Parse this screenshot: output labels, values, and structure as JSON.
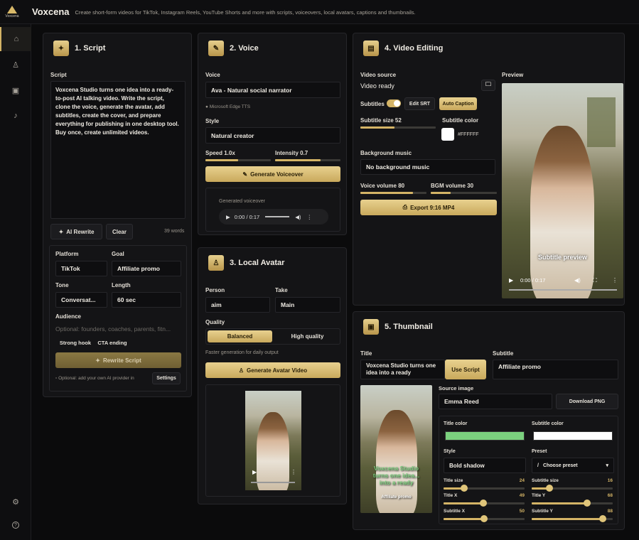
{
  "app": {
    "title": "Voxcena",
    "logo_text": "Voxcena",
    "tagline": "Create short-form videos for TikTok, Instagram Reels, YouTube Shorts and more with scripts, voiceovers, local avatars, captions and thumbnails."
  },
  "sidebar": {
    "items": [
      {
        "name": "home-icon",
        "glyph": "⌂"
      },
      {
        "name": "user-icon",
        "glyph": "♙"
      },
      {
        "name": "image-icon",
        "glyph": "▣"
      },
      {
        "name": "music-icon",
        "glyph": "♪"
      }
    ],
    "bottom": [
      {
        "name": "settings-icon",
        "glyph": "⚙"
      },
      {
        "name": "help-icon",
        "glyph": "?"
      }
    ]
  },
  "script": {
    "title": "1. Script",
    "icon": "sparkle-icon",
    "label": "Script",
    "text": "Voxcena Studio turns one idea into a ready-to-post AI talking video. Write the script, clone the voice, generate the avatar, add subtitles, create the cover, and prepare everything for publishing in one desktop tool. Buy once, create unlimited videos.",
    "ai_rewrite": "AI Rewrite",
    "clear": "Clear",
    "word_count": "39 words",
    "platform_label": "Platform",
    "platform_value": "TikTok",
    "goal_label": "Goal",
    "goal_value": "Affiliate promo",
    "tone_label": "Tone",
    "tone_value": "Conversat...",
    "length_label": "Length",
    "length_value": "60 sec",
    "audience_label": "Audience",
    "audience_placeholder": "Optional: founders, coaches, parents, fitn...",
    "strong_hook": "Strong hook",
    "cta_ending": "CTA ending",
    "rewrite_button": "Rewrite Script",
    "provider_note": "Optional: add your own AI provider in",
    "settings_button": "Settings"
  },
  "voice": {
    "title": "2. Voice",
    "icon": "pen-icon",
    "voice_label": "Voice",
    "voice_value": "Ava - Natural social narrator",
    "engine": "Microsoft Edge TTS",
    "style_label": "Style",
    "style_value": "Natural creator",
    "speed_label": "Speed 1.0x",
    "speed": 0.5,
    "intensity_label": "Intensity 0.7",
    "intensity": 0.7,
    "generate_button": "Generate Voiceover",
    "generated_label": "Generated voiceover",
    "audio_time": "0:00 / 0:17"
  },
  "avatar": {
    "title": "3. Local Avatar",
    "icon": "person-icon",
    "person_label": "Person",
    "person_value": "aim",
    "take_label": "Take",
    "take_value": "Main",
    "quality_label": "Quality",
    "quality_options": [
      "Balanced",
      "High quality"
    ],
    "quality_selected": "Balanced",
    "quality_note": "Faster generation for daily output",
    "generate_button": "Generate Avatar Video"
  },
  "editing": {
    "title": "4. Video Editing",
    "icon": "film-icon",
    "source_label": "Video source",
    "source_value": "Video ready",
    "subtitles_label": "Subtitles",
    "subtitles_on": true,
    "edit_srt": "Edit SRT",
    "auto_caption": "Auto Caption",
    "subtitle_size_label": "Subtitle size 52",
    "subtitle_size": 0.45,
    "subtitle_color_label": "Subtitle color",
    "subtitle_color": "#FFFFFF",
    "bg_music_label": "Background music",
    "bg_music_value": "No background music",
    "voice_volume_label": "Voice volume 80",
    "voice_volume": 0.8,
    "bgm_volume_label": "BGM volume 30",
    "bgm_volume": 0.3,
    "export_button": "Export 9:16 MP4",
    "preview_label": "Preview",
    "subtitle_preview": "Subtitle preview",
    "video_time": "0:00 / 0:17"
  },
  "thumbnail": {
    "title": "5. Thumbnail",
    "icon": "image-icon",
    "title_label": "Title",
    "title_value": "Voxcena Studio turns one idea into a ready",
    "use_script": "Use Script",
    "subtitle_label": "Subtitle",
    "subtitle_value": "Affiliate promo",
    "thumb_title_line1": "Voxcena Studio",
    "thumb_title_line2": "turns one idea...",
    "thumb_title_line3": "into a ready",
    "thumb_subtitle": "Affiliate promo",
    "source_label": "Source image",
    "source_value": "Emma Reed",
    "download_png": "Download PNG",
    "title_color_label": "Title color",
    "title_color": "#7bd17e",
    "subtitle_color_label": "Subtitle color",
    "subtitle_color": "#ffffff",
    "style_label": "Style",
    "style_value": "Bold shadow",
    "preset_label": "Preset",
    "preset_value": "Choose preset",
    "title_size_label": "Title size",
    "title_size_value": "24",
    "title_size": 0.25,
    "sub_size_label": "Subtitle size",
    "sub_size_value": "16",
    "sub_size": 0.22,
    "title_x_label": "Title X",
    "title_x_value": "49",
    "title_x": 0.49,
    "title_y_label": "Title Y",
    "title_y_value": "68",
    "title_y": 0.68,
    "sub_x_label": "Subtitle X",
    "sub_x_value": "50",
    "sub_x": 0.5,
    "sub_y_label": "Subtitle Y",
    "sub_y_value": "88",
    "sub_y": 0.88
  }
}
